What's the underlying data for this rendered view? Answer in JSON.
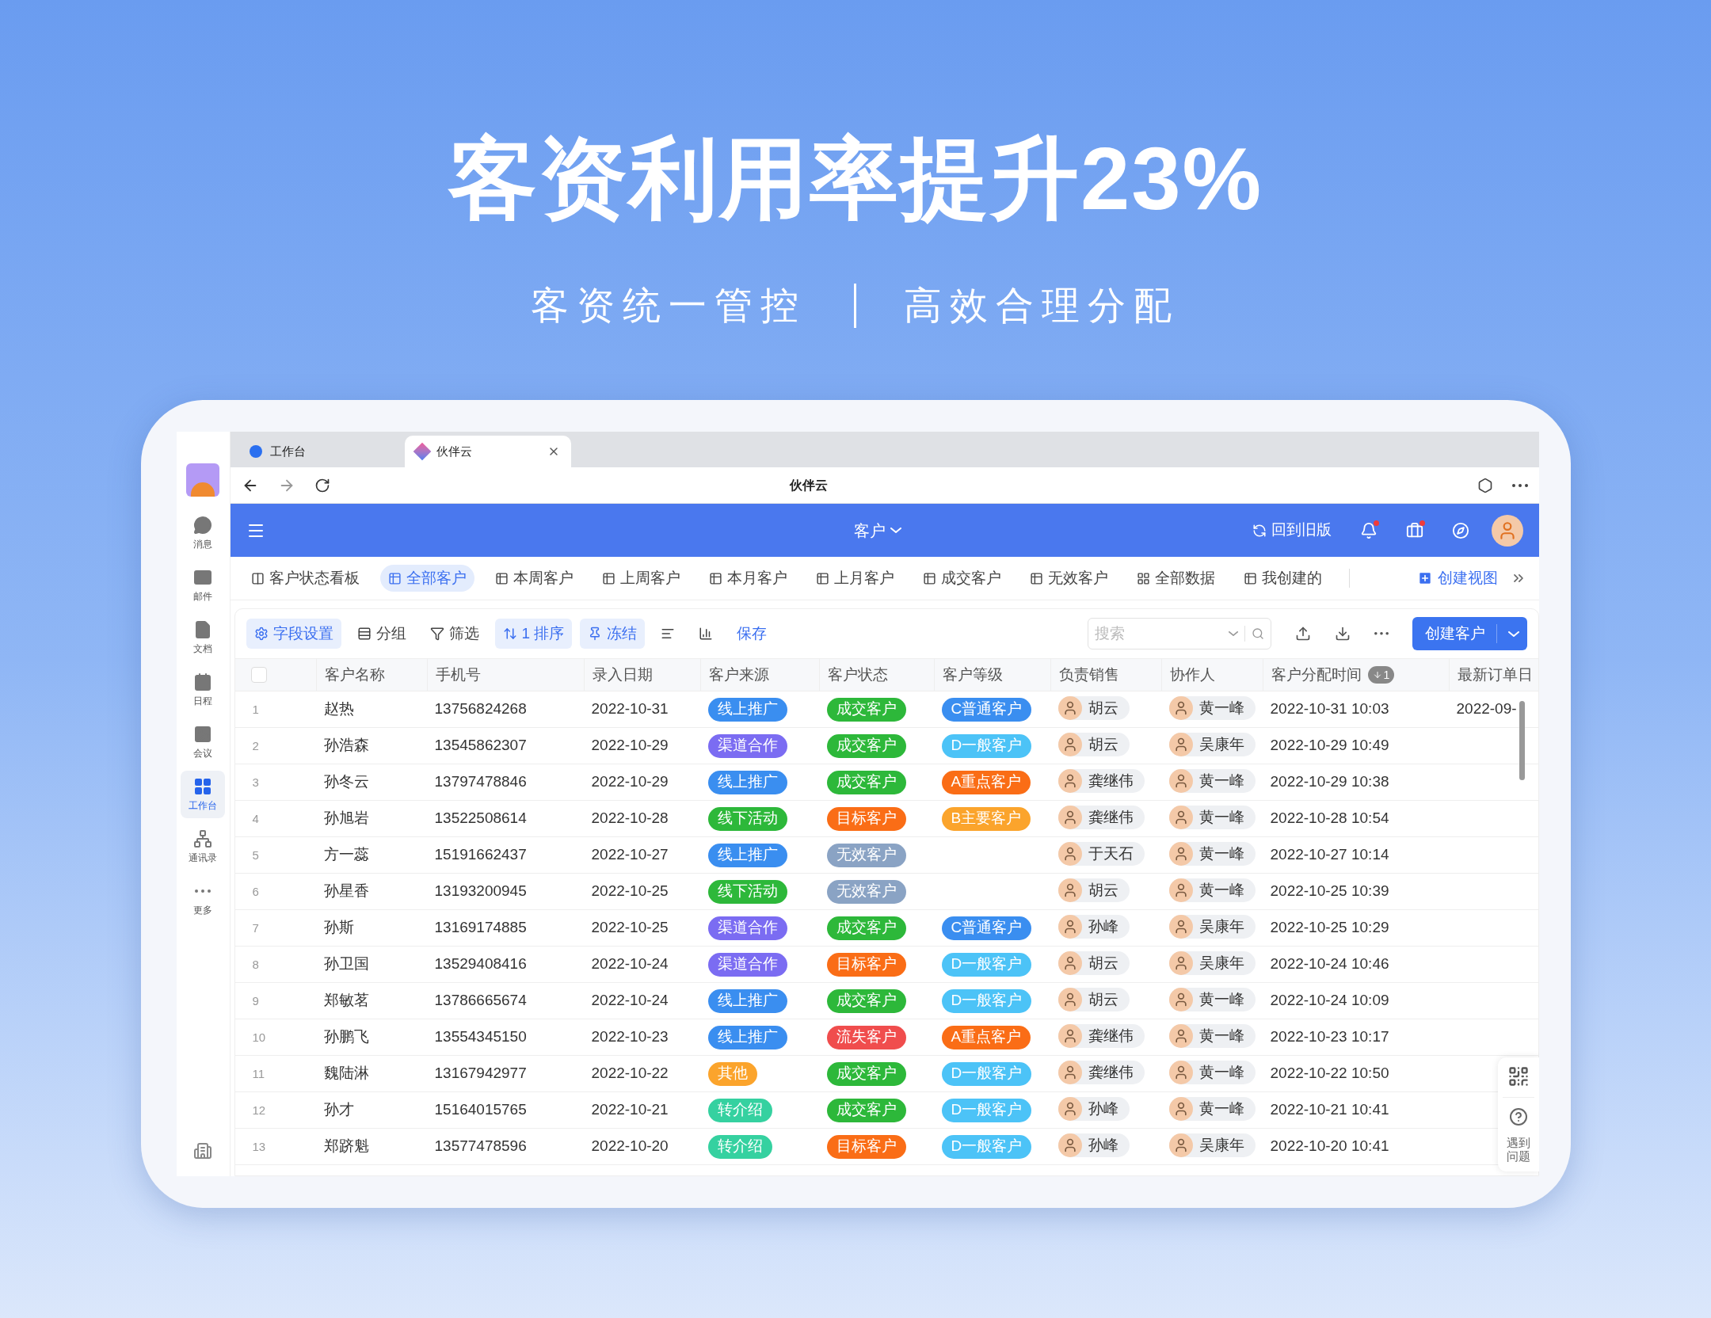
{
  "headline": "客资利用率提升23%",
  "subtitle": [
    "客资统一管控",
    "高效合理分配"
  ],
  "sidebar": {
    "items": [
      {
        "label": "消息",
        "kind": "message",
        "selected": false
      },
      {
        "label": "邮件",
        "kind": "mail",
        "selected": false
      },
      {
        "label": "文档",
        "kind": "doc",
        "selected": false
      },
      {
        "label": "日程",
        "kind": "calendar",
        "selected": false
      },
      {
        "label": "会议",
        "kind": "meeting",
        "selected": false
      },
      {
        "label": "工作台",
        "kind": "grid",
        "selected": true
      },
      {
        "label": "通讯录",
        "kind": "org",
        "selected": false
      },
      {
        "label": "更多",
        "kind": "more",
        "selected": false
      }
    ]
  },
  "browser": {
    "tabs": [
      {
        "label": "工作台",
        "selected": false
      },
      {
        "label": "伙伴云",
        "selected": true
      }
    ],
    "title": "伙伴云"
  },
  "header": {
    "title": "客户",
    "old_version": "回到旧版"
  },
  "views": {
    "items": [
      {
        "label": "客户状态看板",
        "kind": "board",
        "selected": false
      },
      {
        "label": "全部客户",
        "kind": "table",
        "selected": true
      },
      {
        "label": "本周客户",
        "kind": "table",
        "selected": false
      },
      {
        "label": "上周客户",
        "kind": "table",
        "selected": false
      },
      {
        "label": "本月客户",
        "kind": "table",
        "selected": false
      },
      {
        "label": "上月客户",
        "kind": "table",
        "selected": false
      },
      {
        "label": "成交客户",
        "kind": "table",
        "selected": false
      },
      {
        "label": "无效客户",
        "kind": "table",
        "selected": false
      },
      {
        "label": "全部数据",
        "kind": "grid",
        "selected": false
      },
      {
        "label": "我创建的",
        "kind": "table",
        "selected": false
      }
    ],
    "create": "创建视图"
  },
  "toolbar": {
    "buttons": [
      {
        "label": "字段设置",
        "kind": "settings",
        "active": true
      },
      {
        "label": "分组",
        "kind": "group",
        "active": false
      },
      {
        "label": "筛选",
        "kind": "filter",
        "active": false
      },
      {
        "label": "1 排序",
        "kind": "sort",
        "active": true
      },
      {
        "label": "冻结",
        "kind": "freeze",
        "active": true
      },
      {
        "kind": "rowheight",
        "active": false
      },
      {
        "kind": "chart",
        "active": false
      }
    ],
    "save": "保存",
    "search": {
      "placeholder": "搜索"
    },
    "create": "创建客户"
  },
  "table": {
    "select_all": {
      "checked": false
    },
    "columns": [
      {
        "label": "客户名称"
      },
      {
        "label": "手机号"
      },
      {
        "label": "录入日期"
      },
      {
        "label": "客户来源"
      },
      {
        "label": "客户状态"
      },
      {
        "label": "客户等级"
      },
      {
        "label": "负责销售"
      },
      {
        "label": "协作人"
      },
      {
        "label": "客户分配时间",
        "sort": "1"
      },
      {
        "label": "最新订单日"
      }
    ],
    "rows": [
      {
        "index": "1",
        "name": "赵热",
        "phone": "13756824268",
        "date": "2022-10-31",
        "source": {
          "label": "线上推广",
          "color": "#3a8ef0"
        },
        "status": {
          "label": "成交客户",
          "color": "#2db83a"
        },
        "level": {
          "label": "C普通客户",
          "color": "#3a8ef0"
        },
        "sales": "胡云",
        "partner": "黄一峰",
        "time": "2022-10-31 10:03",
        "latest": "2022-09-"
      },
      {
        "index": "2",
        "name": "孙浩森",
        "phone": "13545862307",
        "date": "2022-10-29",
        "source": {
          "label": "渠道合作",
          "color": "#7b6cf2"
        },
        "status": {
          "label": "成交客户",
          "color": "#2db83a"
        },
        "level": {
          "label": "D一般客户",
          "color": "#4cc3f7"
        },
        "sales": "胡云",
        "partner": "吴康年",
        "time": "2022-10-29 10:49"
      },
      {
        "index": "3",
        "name": "孙冬云",
        "phone": "13797478846",
        "date": "2022-10-29",
        "source": {
          "label": "线上推广",
          "color": "#3a8ef0"
        },
        "status": {
          "label": "成交客户",
          "color": "#2db83a"
        },
        "level": {
          "label": "A重点客户",
          "color": "#fa6d16"
        },
        "sales": "龚继伟",
        "partner": "黄一峰",
        "time": "2022-10-29 10:38"
      },
      {
        "index": "4",
        "name": "孙旭岩",
        "phone": "13522508614",
        "date": "2022-10-28",
        "source": {
          "label": "线下活动",
          "color": "#2db83a"
        },
        "status": {
          "label": "目标客户",
          "color": "#fa6d16"
        },
        "level": {
          "label": "B主要客户",
          "color": "#fba42c"
        },
        "sales": "龚继伟",
        "partner": "黄一峰",
        "time": "2022-10-28 10:54"
      },
      {
        "index": "5",
        "name": "方一蕊",
        "phone": "15191662437",
        "date": "2022-10-27",
        "source": {
          "label": "线上推广",
          "color": "#3a8ef0"
        },
        "status": {
          "label": "无效客户",
          "color": "#8aa3c4"
        },
        "sales": "于天石",
        "partner": "黄一峰",
        "time": "2022-10-27 10:14"
      },
      {
        "index": "6",
        "name": "孙星香",
        "phone": "13193200945",
        "date": "2022-10-25",
        "source": {
          "label": "线下活动",
          "color": "#2db83a"
        },
        "status": {
          "label": "无效客户",
          "color": "#8aa3c4"
        },
        "sales": "胡云",
        "partner": "黄一峰",
        "time": "2022-10-25 10:39"
      },
      {
        "index": "7",
        "name": "孙斯",
        "phone": "13169174885",
        "date": "2022-10-25",
        "source": {
          "label": "渠道合作",
          "color": "#7b6cf2"
        },
        "status": {
          "label": "成交客户",
          "color": "#2db83a"
        },
        "level": {
          "label": "C普通客户",
          "color": "#3a8ef0"
        },
        "sales": "孙峰",
        "partner": "吴康年",
        "time": "2022-10-25 10:29"
      },
      {
        "index": "8",
        "name": "孙卫国",
        "phone": "13529408416",
        "date": "2022-10-24",
        "source": {
          "label": "渠道合作",
          "color": "#7b6cf2"
        },
        "status": {
          "label": "目标客户",
          "color": "#fa6d16"
        },
        "level": {
          "label": "D一般客户",
          "color": "#4cc3f7"
        },
        "sales": "胡云",
        "partner": "吴康年",
        "time": "2022-10-24 10:46"
      },
      {
        "index": "9",
        "name": "郑敏茗",
        "phone": "13786665674",
        "date": "2022-10-24",
        "source": {
          "label": "线上推广",
          "color": "#3a8ef0"
        },
        "status": {
          "label": "成交客户",
          "color": "#2db83a"
        },
        "level": {
          "label": "D一般客户",
          "color": "#4cc3f7"
        },
        "sales": "胡云",
        "partner": "黄一峰",
        "time": "2022-10-24 10:09"
      },
      {
        "index": "10",
        "name": "孙鹏飞",
        "phone": "13554345150",
        "date": "2022-10-23",
        "source": {
          "label": "线上推广",
          "color": "#3a8ef0"
        },
        "status": {
          "label": "流失客户",
          "color": "#f04d4d"
        },
        "level": {
          "label": "A重点客户",
          "color": "#fa6d16"
        },
        "sales": "龚继伟",
        "partner": "黄一峰",
        "time": "2022-10-23 10:17"
      },
      {
        "index": "11",
        "name": "魏陆淋",
        "phone": "13167942977",
        "date": "2022-10-22",
        "source": {
          "label": "其他",
          "color": "#fba42c"
        },
        "status": {
          "label": "成交客户",
          "color": "#2db83a"
        },
        "level": {
          "label": "D一般客户",
          "color": "#4cc3f7"
        },
        "sales": "龚继伟",
        "partner": "黄一峰",
        "time": "2022-10-22 10:50"
      },
      {
        "index": "12",
        "name": "孙才",
        "phone": "15164015765",
        "date": "2022-10-21",
        "source": {
          "label": "转介绍",
          "color": "#35d1a0"
        },
        "status": {
          "label": "成交客户",
          "color": "#2db83a"
        },
        "level": {
          "label": "D一般客户",
          "color": "#4cc3f7"
        },
        "sales": "孙峰",
        "partner": "黄一峰",
        "time": "2022-10-21 10:41"
      },
      {
        "index": "13",
        "name": "郑跻魁",
        "phone": "13577478596",
        "date": "2022-10-20",
        "source": {
          "label": "转介绍",
          "color": "#35d1a0"
        },
        "status": {
          "label": "目标客户",
          "color": "#fa6d16"
        },
        "level": {
          "label": "D一般客户",
          "color": "#4cc3f7"
        },
        "sales": "孙峰",
        "partner": "吴康年",
        "time": "2022-10-20 10:41"
      }
    ]
  },
  "help_panel": {
    "label": "遇到问题"
  }
}
